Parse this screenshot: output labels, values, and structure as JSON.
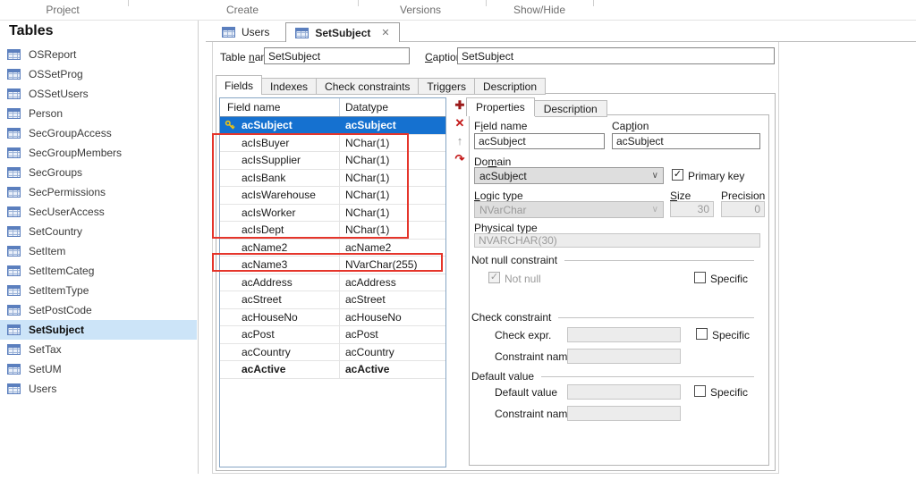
{
  "ribbon": {
    "groups": [
      {
        "label": "Project"
      },
      {
        "label": "Create"
      },
      {
        "label": "Versions"
      },
      {
        "label": "Show/Hide"
      }
    ]
  },
  "sidebar": {
    "title": "Tables",
    "items": [
      {
        "label": "OSReport",
        "selected": false
      },
      {
        "label": "OSSetProg",
        "selected": false
      },
      {
        "label": "OSSetUsers",
        "selected": false
      },
      {
        "label": "Person",
        "selected": false
      },
      {
        "label": "SecGroupAccess",
        "selected": false
      },
      {
        "label": "SecGroupMembers",
        "selected": false
      },
      {
        "label": "SecGroups",
        "selected": false
      },
      {
        "label": "SecPermissions",
        "selected": false
      },
      {
        "label": "SecUserAccess",
        "selected": false
      },
      {
        "label": "SetCountry",
        "selected": false
      },
      {
        "label": "SetItem",
        "selected": false
      },
      {
        "label": "SetItemCateg",
        "selected": false
      },
      {
        "label": "SetItemType",
        "selected": false
      },
      {
        "label": "SetPostCode",
        "selected": false
      },
      {
        "label": "SetSubject",
        "selected": true
      },
      {
        "label": "SetTax",
        "selected": false
      },
      {
        "label": "SetUM",
        "selected": false
      },
      {
        "label": "Users",
        "selected": false
      }
    ]
  },
  "doc_tabs": [
    {
      "label": "Users",
      "active": false
    },
    {
      "label": "SetSubject",
      "active": true,
      "closable": true
    }
  ],
  "form": {
    "table_name_label": "Table [n]ame",
    "table_name_value": "SetSubject",
    "caption_label": "[C]aption",
    "caption_value": "SetSubject"
  },
  "editor_tabs": [
    {
      "label": "Fields",
      "active": true
    },
    {
      "label": "Indexes",
      "active": false
    },
    {
      "label": "Check constraints",
      "active": false
    },
    {
      "label": "Triggers",
      "active": false
    },
    {
      "label": "Description",
      "active": false
    }
  ],
  "grid": {
    "columns": [
      "Field name",
      "Datatype"
    ],
    "rows": [
      {
        "field": "acSubject",
        "type": "acSubject",
        "selected": true,
        "key": true,
        "bold": true
      },
      {
        "field": "acIsBuyer",
        "type": "NChar(1)"
      },
      {
        "field": "acIsSupplier",
        "type": "NChar(1)"
      },
      {
        "field": "acIsBank",
        "type": "NChar(1)"
      },
      {
        "field": "acIsWarehouse",
        "type": "NChar(1)"
      },
      {
        "field": "acIsWorker",
        "type": "NChar(1)"
      },
      {
        "field": "acIsDept",
        "type": "NChar(1)"
      },
      {
        "field": "acName2",
        "type": "acName2"
      },
      {
        "field": "acName3",
        "type": "NVarChar(255)"
      },
      {
        "field": "acAddress",
        "type": "acAddress"
      },
      {
        "field": "acStreet",
        "type": "acStreet"
      },
      {
        "field": "acHouseNo",
        "type": "acHouseNo"
      },
      {
        "field": "acPost",
        "type": "acPost"
      },
      {
        "field": "acCountry",
        "type": "acCountry"
      },
      {
        "field": "acActive",
        "type": "acActive",
        "bold": true
      }
    ]
  },
  "toolbar": {
    "add_icon": "✚",
    "delete_icon": "✕",
    "move_up_icon": "↑",
    "move_down_icon": "↷"
  },
  "properties": {
    "tabs": [
      {
        "label": "Properties",
        "active": true
      },
      {
        "label": "Description",
        "active": false
      }
    ],
    "field_name_label": "F[i]eld name",
    "field_name_value": "acSubject",
    "caption_label": "Cap[t]ion",
    "caption_value": "acSubject",
    "domain_label": "Do[m]ain",
    "domain_value": "acSubject",
    "primary_key_label": "Primary key",
    "primary_key_checked": true,
    "logic_type_label": "[L]ogic type",
    "logic_type_value": "NVarChar",
    "size_label": "[S]ize",
    "size_value": "30",
    "precision_label": "Precision",
    "precision_value": "0",
    "physical_type_label": "Physical type",
    "physical_type_value": "NVARCHAR(30)",
    "not_null_group": {
      "title": "Not null constraint",
      "not_null_label": "Not null",
      "not_null_checked": true,
      "specific_label": "Specific",
      "specific_checked": false
    },
    "check_group": {
      "title": "Check constraint",
      "check_expr_label": "Check expr.",
      "check_expr_value": "",
      "constraint_name_label": "Constraint name",
      "constraint_name_value": "",
      "specific_label": "Specific",
      "specific_checked": false
    },
    "default_group": {
      "title": "Default value",
      "default_value_label": "Default value",
      "default_value_value": "",
      "constraint_name_label": "Constraint name",
      "constraint_name_value": "",
      "specific_label": "Specific",
      "specific_checked": false
    }
  },
  "icons": {
    "close": "✕",
    "chevron": "∨",
    "check": "✓",
    "table": "table-grid-icon",
    "key": "primary-key-icon"
  },
  "colors": {
    "selection_blue": "#1571d0",
    "sidebar_selected": "#cce4f8",
    "highlight_red": "#e5352b",
    "toolbar_dark_red": "#9c1b1b",
    "toolbar_red": "#c41919"
  }
}
